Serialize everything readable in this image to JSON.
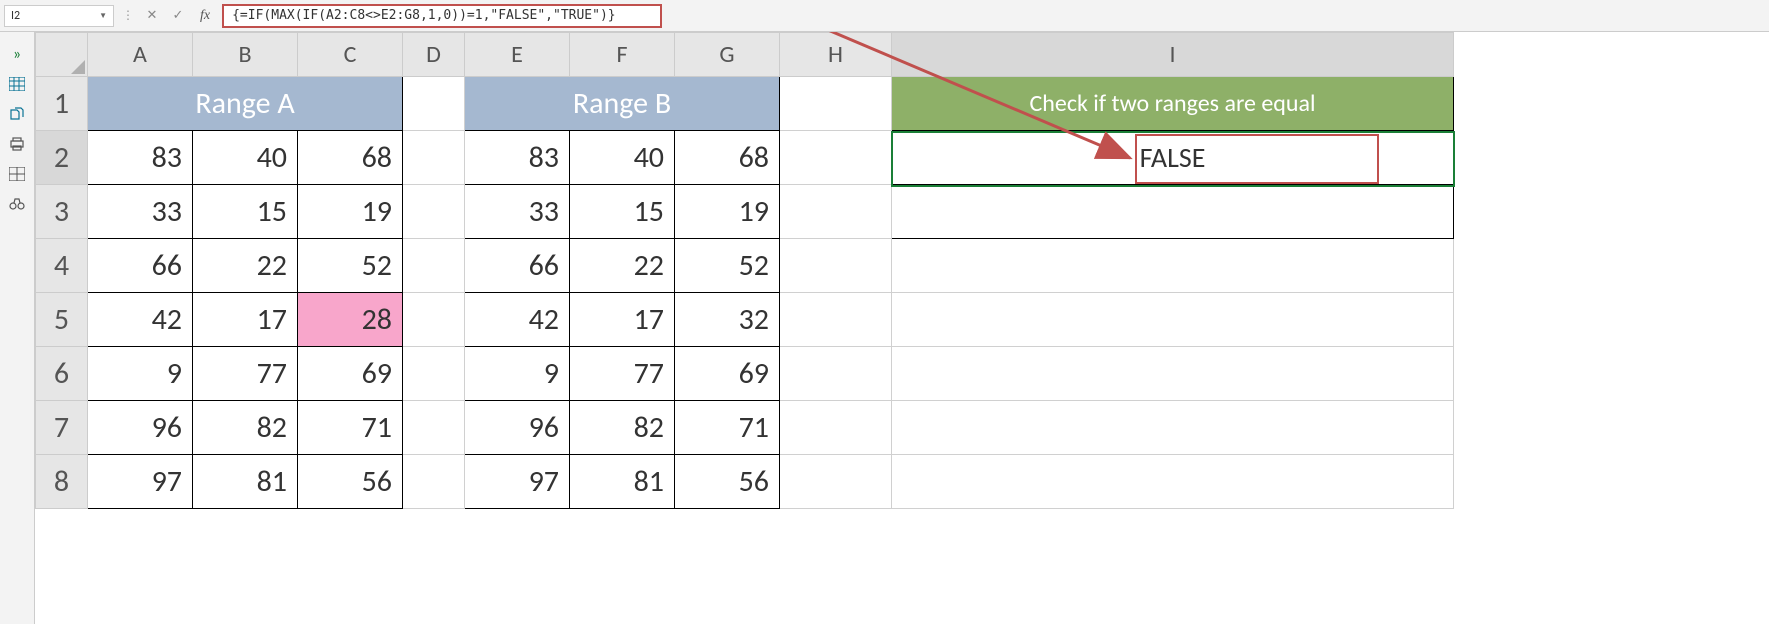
{
  "name_box": "I2",
  "formula": "{=IF(MAX(IF(A2:C8<>E2:G8,1,0))=1,\"FALSE\",\"TRUE\")}",
  "fx_label": "fx",
  "columns": [
    "A",
    "B",
    "C",
    "D",
    "E",
    "F",
    "G",
    "H",
    "I"
  ],
  "rows": [
    "1",
    "2",
    "3",
    "4",
    "5",
    "6",
    "7",
    "8"
  ],
  "rangeA_title": "Range A",
  "rangeB_title": "Range B",
  "check_title": "Check if two ranges are equal",
  "result": "FALSE",
  "rangeA": [
    {
      "a": "83",
      "b": "40",
      "c": "68"
    },
    {
      "a": "33",
      "b": "15",
      "c": "19"
    },
    {
      "a": "66",
      "b": "22",
      "c": "52"
    },
    {
      "a": "42",
      "b": "17",
      "c": "28"
    },
    {
      "a": "9",
      "b": "77",
      "c": "69"
    },
    {
      "a": "96",
      "b": "82",
      "c": "71"
    },
    {
      "a": "97",
      "b": "81",
      "c": "56"
    }
  ],
  "rangeB": [
    {
      "e": "83",
      "f": "40",
      "g": "68"
    },
    {
      "e": "33",
      "f": "15",
      "g": "19"
    },
    {
      "e": "66",
      "f": "22",
      "g": "52"
    },
    {
      "e": "42",
      "f": "17",
      "g": "32"
    },
    {
      "e": "9",
      "f": "77",
      "g": "69"
    },
    {
      "e": "96",
      "f": "82",
      "g": "71"
    },
    {
      "e": "97",
      "f": "81",
      "g": "56"
    }
  ],
  "icons": {
    "expand": "»",
    "cancel": "✕",
    "enter": "✓"
  }
}
